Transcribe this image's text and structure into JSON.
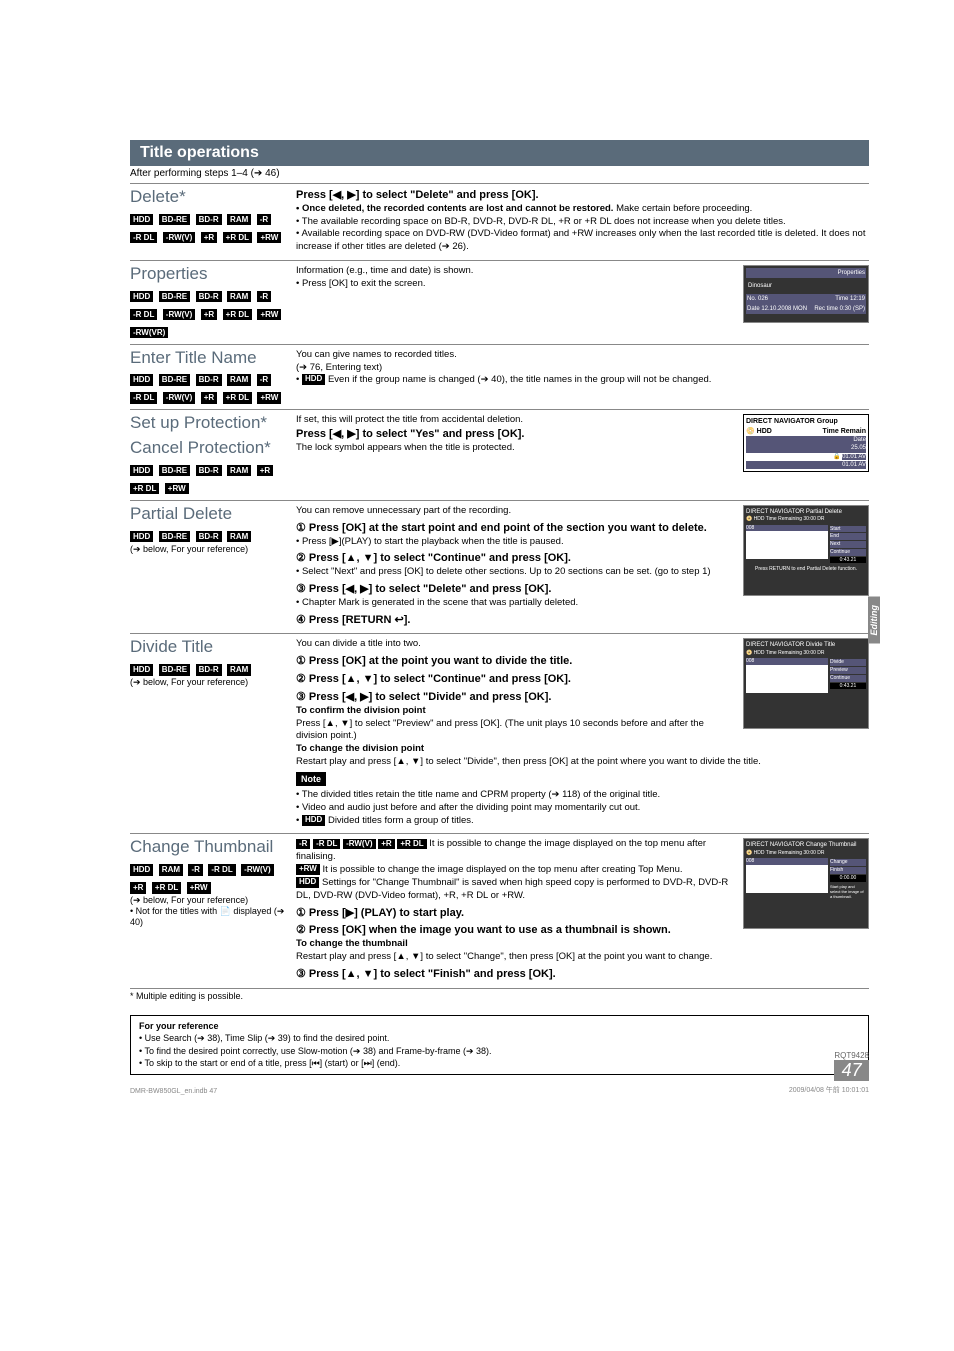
{
  "section_title": "Title operations",
  "after_steps": "After performing steps 1–4 (➔ 46)",
  "side_tab": "Editing",
  "ops": {
    "delete": {
      "title": "Delete*",
      "badges": [
        "HDD",
        "BD-RE",
        "BD-R",
        "RAM",
        "-R",
        "-R DL",
        "-RW(V)",
        "+R",
        "+R DL",
        "+RW"
      ],
      "line1": "Press [◀, ▶] to select \"Delete\" and press [OK].",
      "b1": "• Once deleted, the recorded contents are lost and cannot be restored.",
      "b1b": " Make certain before proceeding.",
      "b2": "• The available recording space on BD-R, DVD-R, DVD-R DL, +R or +R DL does not increase when you delete titles.",
      "b3": "• Available recording space on DVD-RW (DVD-Video format) and +RW increases only when the last recorded title is deleted. It does not increase if other titles are deleted (➔ 26)."
    },
    "properties": {
      "title": "Properties",
      "badges": [
        "HDD",
        "BD-RE",
        "BD-R",
        "RAM",
        "-R",
        "-R DL",
        "-RW(V)",
        "+R",
        "+R DL",
        "+RW",
        "-RW(VR)"
      ],
      "line1": "Information (e.g., time and date) is shown.",
      "line2": "• Press [OK] to exit the screen.",
      "popup": {
        "title": "Properties",
        "name": "Dinosaur",
        "no": "No. 026",
        "time": "Time 12:19",
        "date": "Date 12.10.2008 MON",
        "rec": "Rec time 0:30 (SP)"
      }
    },
    "entertitle": {
      "title": "Enter Title Name",
      "badges": [
        "HDD",
        "BD-RE",
        "BD-R",
        "RAM",
        "-R",
        "-R DL",
        "-RW(V)",
        "+R",
        "+R DL",
        "+RW"
      ],
      "line1": "You can give names to recorded titles.",
      "line2": "(➔ 76, Entering text)",
      "line3a": "HDD",
      "line3b": " Even if the group name is changed (➔ 40), the title names in the group will not be changed."
    },
    "protection": {
      "title1": "Set up Protection*",
      "title2": "Cancel Protection*",
      "badges": [
        "HDD",
        "BD-RE",
        "BD-R",
        "RAM",
        "+R",
        "+R DL",
        "+RW"
      ],
      "line1": "If set, this will protect the title from accidental deletion.",
      "line2": "Press [◀, ▶] to select \"Yes\" and press [OK].",
      "line3": "The lock symbol appears when the title is protected.",
      "popup": {
        "header": "DIRECT NAVIGATOR  Group",
        "drive": "HDD",
        "col": "Time Remain",
        "date": "Date",
        "t1": "25.05",
        "t2": "01.01 AV",
        "t3": "01.01 AV"
      }
    },
    "partial": {
      "title": "Partial Delete",
      "badges": [
        "HDD",
        "BD-RE",
        "BD-R",
        "RAM"
      ],
      "sub": "(➔ below, For your reference)",
      "line1": "You can remove unnecessary part of the recording.",
      "s1": "① Press [OK] at the start point and end point of the section you want to delete.",
      "s1b": "• Press [▶](PLAY) to start the playback when the title is paused.",
      "s2": "② Press [▲, ▼] to select \"Continue\" and press [OK].",
      "s2b": "• Select \"Next\" and press [OK] to delete other sections. Up to 20 sections can be set. (go to step 1)",
      "s3": "③ Press [◀, ▶] to select \"Delete\" and press [OK].",
      "s3b": "• Chapter Mark is generated in the scene that was partially deleted.",
      "s4": "④ Press [RETURN ↩].",
      "popup": {
        "header": "DIRECT NAVIGATOR    Partial Delete",
        "drive": "HDD",
        "time": "Time Remaining 30:00 DR",
        "item": "008",
        "btns": [
          "Start",
          "End",
          "Next",
          "Continue"
        ],
        "t": "0:43.21",
        "foot": "Press RETURN to end Partial Delete function."
      }
    },
    "divide": {
      "title": "Divide Title",
      "badges": [
        "HDD",
        "BD-RE",
        "BD-R",
        "RAM"
      ],
      "sub": "(➔ below, For your reference)",
      "line1": "You can divide a title into two.",
      "s1": "① Press [OK] at the point you want to divide the title.",
      "s2": "② Press [▲, ▼] to select \"Continue\" and press [OK].",
      "s3": "③ Press [◀, ▶] to select \"Divide\" and press [OK].",
      "conf": "To confirm the division point",
      "confb": "Press [▲, ▼] to select \"Preview\" and press [OK]. (The unit plays 10 seconds before and after the division point.)",
      "chg": "To change the division point",
      "chgb": "Restart play and press [▲, ▼] to select \"Divide\", then press [OK] at the point where you want to divide the title.",
      "note": "Note",
      "n1": "• The divided titles retain the title name and CPRM property (➔ 118) of the original title.",
      "n2": "• Video and audio just before and after the dividing point may momentarily cut out.",
      "n3a": "HDD",
      "n3b": " Divided titles form a group of titles.",
      "popup": {
        "header": "DIRECT NAVIGATOR    Divide Title",
        "drive": "HDD",
        "time": "Time Remaining 30:00 DR",
        "item": "008",
        "btns": [
          "Divide",
          "Preview",
          "Continue"
        ],
        "t": "0:43.21"
      }
    },
    "thumbnail": {
      "title": "Change Thumbnail",
      "badges": [
        "HDD",
        "RAM",
        "-R",
        "-R DL",
        "-RW(V)",
        "+R",
        "+R DL",
        "+RW"
      ],
      "sub1": "(➔ below, For your reference)",
      "sub2": "• Not for the titles with 📄 displayed (➔ 40)",
      "inline1": [
        "-R",
        "-R DL",
        "-RW(V)",
        "+R",
        "+R DL"
      ],
      "inline1b": " It is possible to change the image displayed on the top menu after finalising.",
      "inline2a": "+RW",
      "inline2b": " It is possible to change the image displayed on the top menu after creating Top Menu.",
      "inline3a": "HDD",
      "inline3b": " Settings for \"Change Thumbnail\" is saved when high speed copy is performed to DVD-R, DVD-R DL, DVD-RW (DVD-Video format), +R, +R DL or +RW.",
      "s1": "① Press [▶] (PLAY) to start play.",
      "s2": "② Press [OK] when the image you want to use as a thumbnail is shown.",
      "chg": "To change the thumbnail",
      "chgb": "Restart play and press [▲, ▼] to select \"Change\", then press [OK] at the point you want to change.",
      "s3": "③ Press [▲, ▼] to select \"Finish\" and press [OK].",
      "popup": {
        "header": "DIRECT NAVIGATOR  Change Thumbnail",
        "drive": "HDD",
        "time": "Time Remaining 30:00 DR",
        "item": "008",
        "btns": [
          "Change",
          "Finish"
        ],
        "t": "0:00.00",
        "msg": "Start play and select the image of a thumbnail."
      }
    }
  },
  "footnote": "* Multiple editing is possible.",
  "refbox": {
    "heading": "For your reference",
    "l1": "• Use Search (➔ 38), Time Slip (➔ 39) to find the desired point.",
    "l2": "• To find the desired point correctly, use Slow-motion (➔ 38) and Frame-by-frame (➔ 38).",
    "l3": "• To skip to the start or end of a title, press [⏮] (start) or [⏭] (end)."
  },
  "page_num_top": "RQT9428",
  "page_num": "47",
  "footer_left": "DMR-BW850GL_en.indb   47",
  "footer_right": "2009/04/08   午前 10:01:01"
}
